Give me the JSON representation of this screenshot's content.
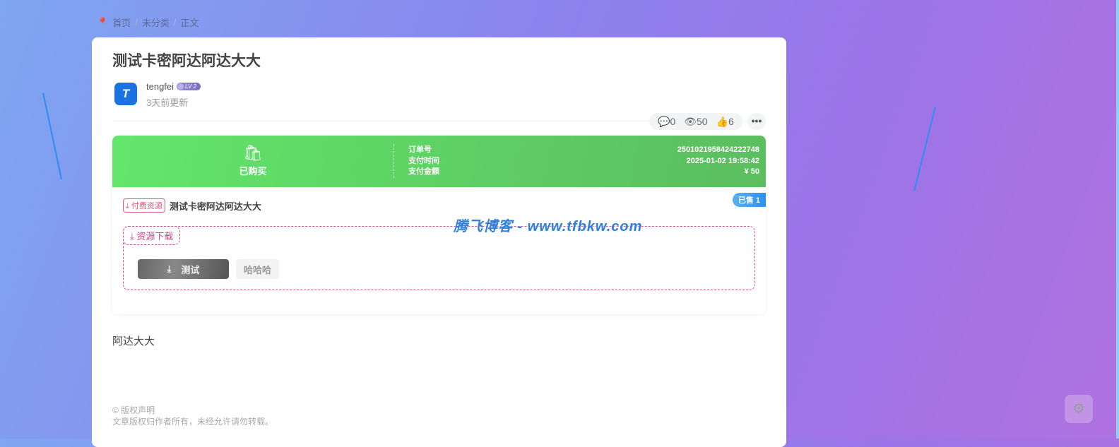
{
  "breadcrumb": {
    "items": [
      "首页",
      "未分类",
      "正文"
    ],
    "separator": "/"
  },
  "post": {
    "title": "测试卡密阿达阿达大大",
    "author": "tengfei",
    "level": "LV 2",
    "avatar_text": "T",
    "updated": "3天前更新",
    "body": "阿达大大"
  },
  "stats": {
    "comments": "0",
    "views": "50",
    "likes": "6",
    "more": "•••"
  },
  "purchase": {
    "status": "已购买",
    "order_label": "订单号",
    "order_no": "2501021958424222748",
    "time_label": "支付时间",
    "time": "2025-01-02 19:58:42",
    "amount_label": "支付金额",
    "amount": "¥ 50"
  },
  "resource": {
    "tag": "付费资源",
    "name": "测试卡密阿达阿达大大",
    "sold": "已售 1",
    "download_label": "资源下载",
    "buttons": [
      "测试",
      "哈哈哈"
    ]
  },
  "watermark": "腾飞博客 - www.tfbkw.com",
  "copyright": {
    "title": "© 版权声明",
    "text": "文章版权归作者所有，未经允许请勿转载。"
  }
}
